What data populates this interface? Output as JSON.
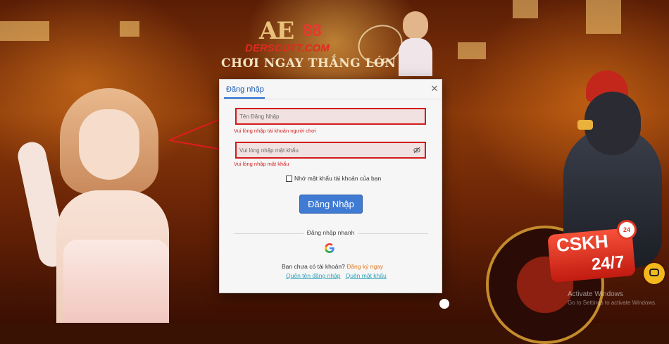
{
  "branding": {
    "logo_main": "AE",
    "logo_number": "88",
    "logo_site": "DERSCUTT.COM",
    "tagline": "CHƠI NGAY THẮNG LỚN"
  },
  "modal": {
    "title": "Đăng nhập",
    "close_symbol": "✕",
    "username": {
      "placeholder": "Tên Đăng Nhập",
      "value": "",
      "error": "Vui lòng nhập tài khoản người chơi"
    },
    "password": {
      "placeholder": "Vui lòng nhập mật khẩu",
      "value": "",
      "error": "Vui lòng nhập mật khẩu"
    },
    "remember_label": "Nhớ mật khẩu tài khoản của bạn",
    "login_button": "Đăng Nhập",
    "quick_login_label": "Đăng nhập nhanh",
    "no_account_text": "Bạn chưa có tài khoản?",
    "signup_link": "Đăng ký ngay",
    "forgot_username": "Quên tên đăng nhập",
    "forgot_password": "Quên mật khẩu"
  },
  "support": {
    "cskh_label": "CSKH",
    "cskh_hours": "24/7",
    "badge": "24"
  },
  "os_watermark": {
    "line1": "Activate Windows",
    "line2": "Go to Settings to activate Windows."
  },
  "colors": {
    "accent_blue": "#3f7ad3",
    "error_red": "#d21a1a",
    "link_orange": "#e07a22",
    "link_teal": "#2fa1b8"
  },
  "icons": [
    "close-icon",
    "eye-off-icon",
    "google-icon",
    "chat-icon",
    "arrow-icon"
  ]
}
